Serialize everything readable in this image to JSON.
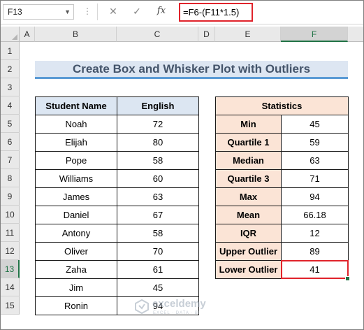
{
  "formula_bar": {
    "name_box": "F13",
    "cancel_icon": "✕",
    "enter_icon": "✓",
    "fx_label": "fx",
    "formula": "=F6-(F11*1.5)"
  },
  "columns": [
    "A",
    "B",
    "C",
    "D",
    "E",
    "F"
  ],
  "selected_column": "F",
  "rows": [
    "1",
    "2",
    "3",
    "4",
    "5",
    "6",
    "7",
    "8",
    "9",
    "10",
    "11",
    "12",
    "13",
    "14",
    "15"
  ],
  "selected_row": "13",
  "title": "Create Box and Whisker Plot with Outliers",
  "students_table": {
    "headers": [
      "Student Name",
      "English"
    ],
    "rows": [
      [
        "Noah",
        "72"
      ],
      [
        "Elijah",
        "80"
      ],
      [
        "Pope",
        "58"
      ],
      [
        "Williams",
        "60"
      ],
      [
        "James",
        "63"
      ],
      [
        "Daniel",
        "67"
      ],
      [
        "Antony",
        "58"
      ],
      [
        "Oliver",
        "70"
      ],
      [
        "Zaha",
        "61"
      ],
      [
        "Jim",
        "45"
      ],
      [
        "Ronin",
        "94"
      ]
    ]
  },
  "stats_table": {
    "header": "Statistics",
    "rows": [
      [
        "Min",
        "45"
      ],
      [
        "Quartile 1",
        "59"
      ],
      [
        "Median",
        "63"
      ],
      [
        "Quartile 3",
        "71"
      ],
      [
        "Max",
        "94"
      ],
      [
        "Mean",
        "66.18"
      ],
      [
        "IQR",
        "12"
      ],
      [
        "Upper Outlier",
        "89"
      ],
      [
        "Lower Outlier",
        "41"
      ]
    ]
  },
  "watermark": {
    "name": "exceldemy",
    "tagline": "EXCEL · DATA · BI"
  },
  "colors": {
    "accent_green": "#217346",
    "selection_red": "#e0232b",
    "title_fill": "#dde6f2",
    "title_underline": "#5b9bd5",
    "pink_fill": "#fbe4d6",
    "blue_fill": "#dce6f2"
  }
}
